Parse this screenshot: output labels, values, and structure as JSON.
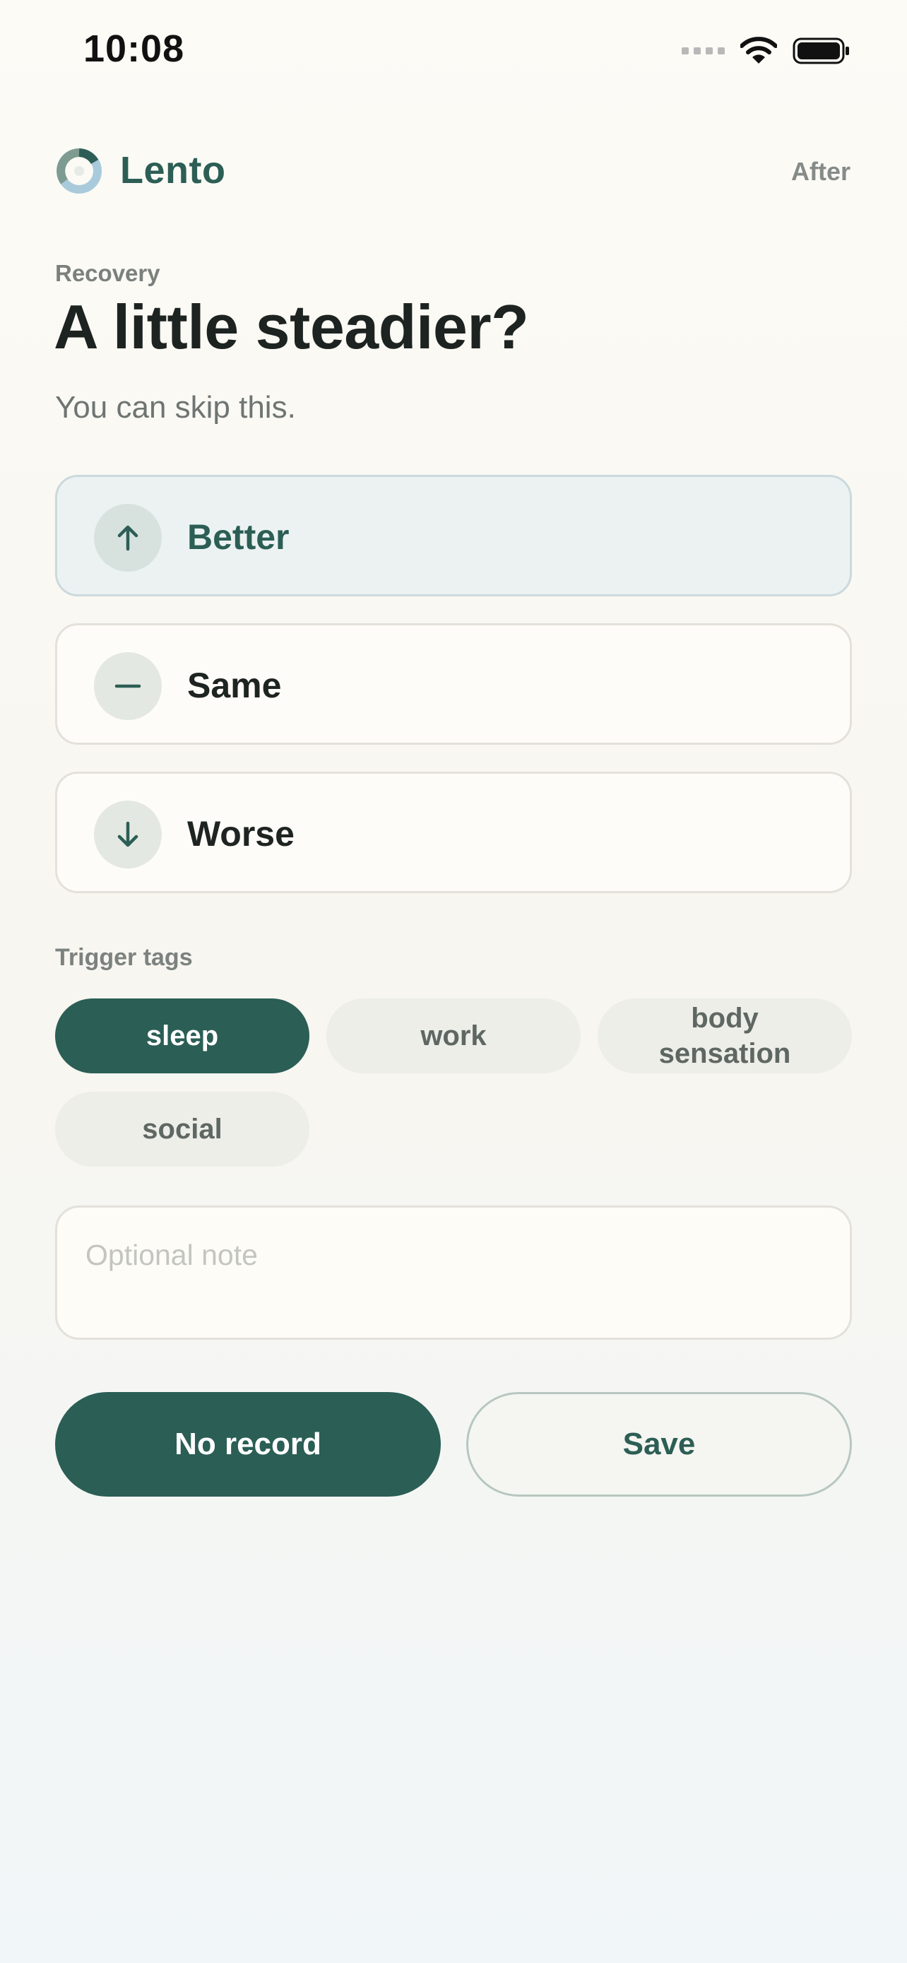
{
  "status_bar": {
    "time": "10:08",
    "icons": [
      "cellular-signal-icon",
      "wifi-icon",
      "battery-icon"
    ]
  },
  "header": {
    "app_name": "Lento",
    "logo_icon": "lento-ring-logo-icon",
    "after_link": "After"
  },
  "intro": {
    "eyebrow": "Recovery",
    "title": "A little steadier?",
    "subtitle": "You can skip this."
  },
  "options": [
    {
      "label": "Better",
      "icon": "arrow-up-icon",
      "selected": true
    },
    {
      "label": "Same",
      "icon": "minus-icon",
      "selected": false
    },
    {
      "label": "Worse",
      "icon": "arrow-down-icon",
      "selected": false
    }
  ],
  "tags": {
    "label": "Trigger tags",
    "items": [
      {
        "label": "sleep",
        "active": true
      },
      {
        "label": "work",
        "active": false
      },
      {
        "label": "body sensation",
        "active": false
      },
      {
        "label": "social",
        "active": false
      }
    ]
  },
  "note": {
    "value": "",
    "placeholder": "Optional note"
  },
  "actions": {
    "no_record": "No record",
    "save": "Save"
  },
  "colors": {
    "accent": "#2b5e55",
    "selected_option_bg": "#ecf2f2",
    "chip_bg": "#edeee8",
    "muted_text": "#7c827f"
  }
}
